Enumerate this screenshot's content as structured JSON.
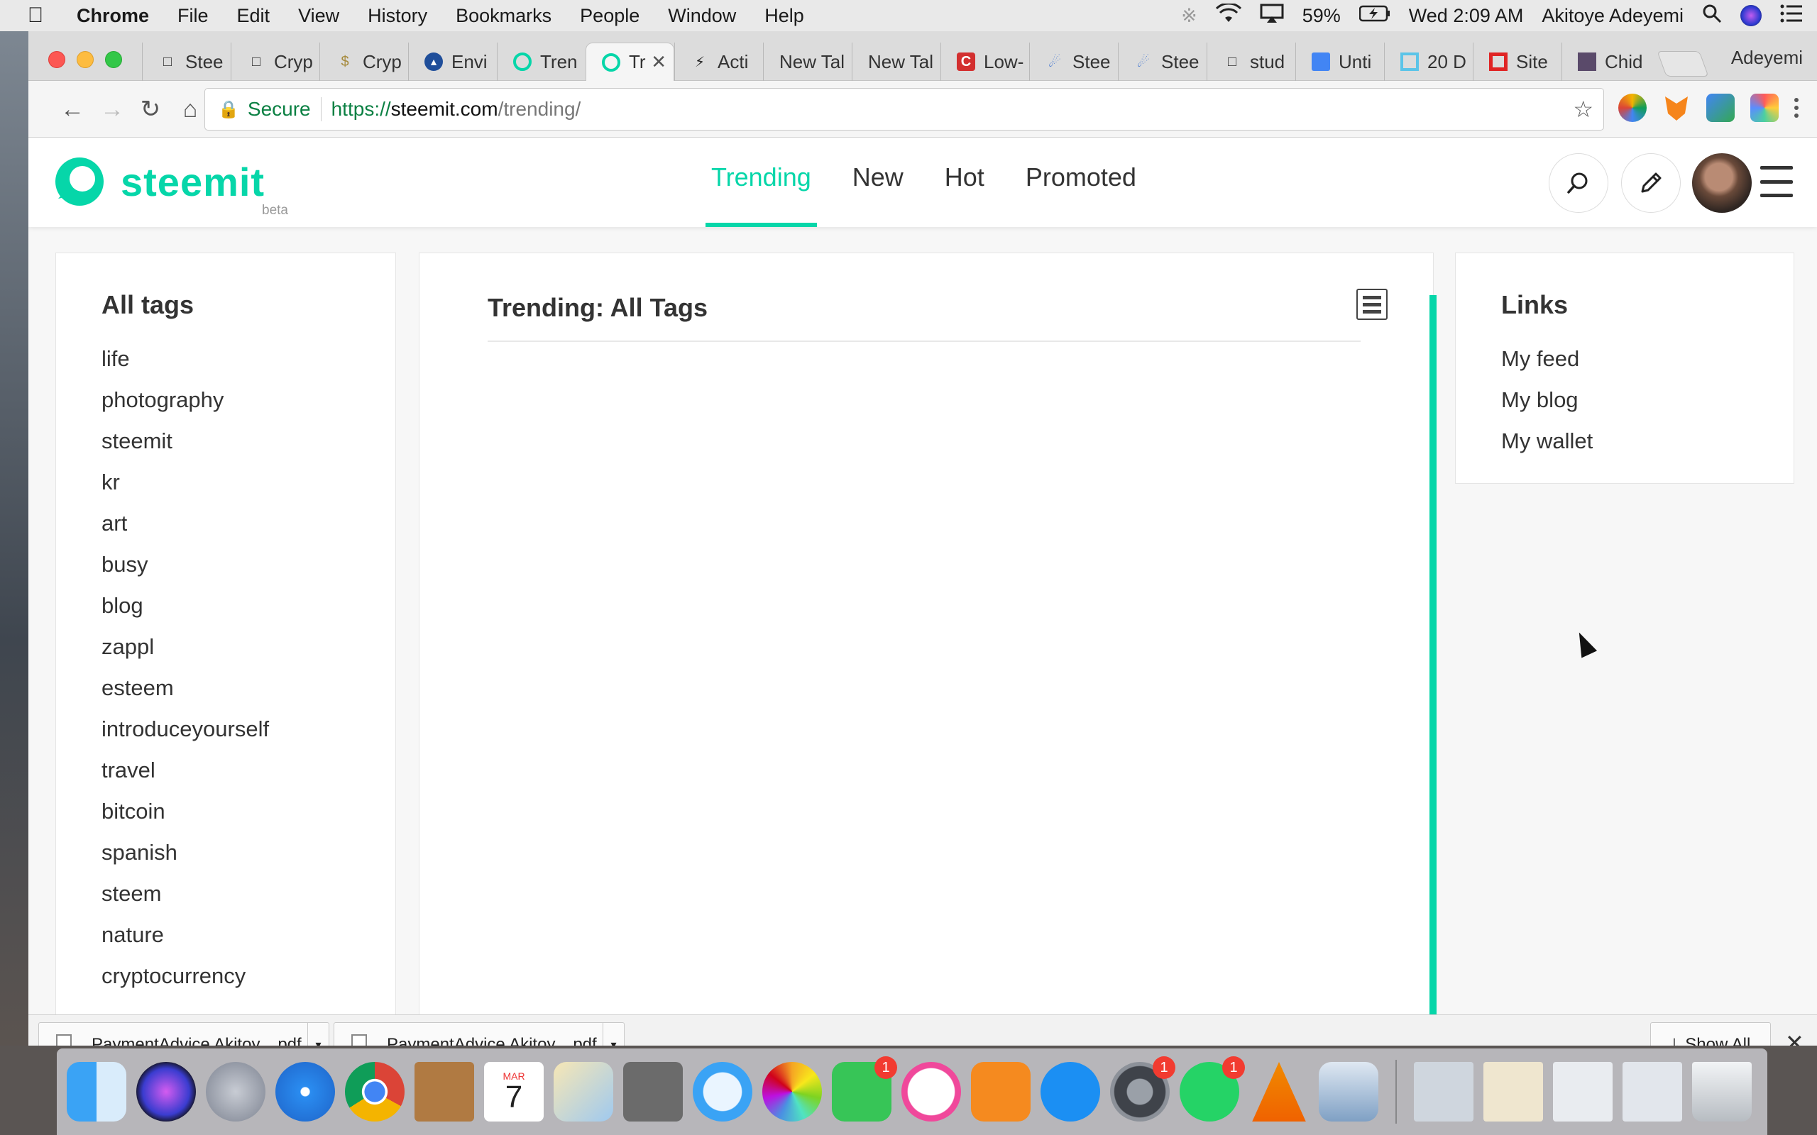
{
  "menubar": {
    "app": "Chrome",
    "items": [
      "File",
      "Edit",
      "View",
      "History",
      "Bookmarks",
      "People",
      "Window",
      "Help"
    ],
    "battery": "59%",
    "clock": "Wed 2:09 AM",
    "user": "Akitoye Adeyemi"
  },
  "browser": {
    "profile_name": "Adeyemi",
    "tabs": [
      {
        "label": "Stee"
      },
      {
        "label": "Cryp"
      },
      {
        "label": "Cryp"
      },
      {
        "label": "Envi"
      },
      {
        "label": "Tren"
      },
      {
        "label": "Tr"
      },
      {
        "label": "Acti"
      },
      {
        "label": "New Tal"
      },
      {
        "label": "New Tal"
      },
      {
        "label": "Low-"
      },
      {
        "label": "Stee"
      },
      {
        "label": "Stee"
      },
      {
        "label": "stud"
      },
      {
        "label": "Unti"
      },
      {
        "label": "20 D"
      },
      {
        "label": "Site"
      },
      {
        "label": "Chid"
      }
    ],
    "omnibox": {
      "secure_label": "Secure",
      "protocol": "https://",
      "host": "steemit.com",
      "path": "/trending/"
    }
  },
  "site": {
    "brand": "steemit",
    "beta": "beta",
    "nav": [
      "Trending",
      "New",
      "Hot",
      "Promoted"
    ],
    "active_nav": "Trending",
    "colors": {
      "accent": "#06d6a9"
    }
  },
  "tags": {
    "title": "All tags",
    "items": [
      "life",
      "photography",
      "steemit",
      "kr",
      "art",
      "busy",
      "blog",
      "zappl",
      "esteem",
      "introduceyourself",
      "travel",
      "bitcoin",
      "spanish",
      "steem",
      "nature",
      "cryptocurrency"
    ]
  },
  "main": {
    "title": "Trending: All Tags"
  },
  "links": {
    "title": "Links",
    "items": [
      "My feed",
      "My blog",
      "My wallet"
    ]
  },
  "downloads": {
    "items": [
      "PaymentAdvice Akitoy....pdf",
      "PaymentAdvice Akitoy....pdf"
    ],
    "show_all": "Show All"
  },
  "dock": {
    "calendar_month": "MAR",
    "calendar_day": "7",
    "badges": {
      "facetime": "1",
      "system_prefs": "1",
      "whatsapp": "1"
    }
  }
}
